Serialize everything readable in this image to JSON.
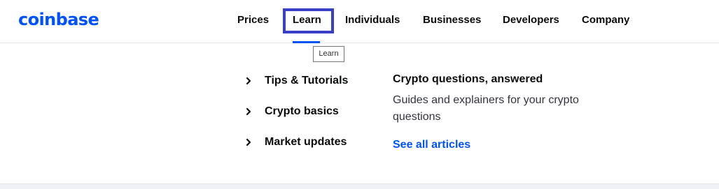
{
  "brand": {
    "logo_text": "coinbase",
    "color": "#0052ff"
  },
  "nav": {
    "items": [
      {
        "label": "Prices"
      },
      {
        "label": "Learn",
        "active": true
      },
      {
        "label": "Individuals"
      },
      {
        "label": "Businesses"
      },
      {
        "label": "Developers"
      },
      {
        "label": "Company"
      }
    ],
    "highlight_color": "#3a3fc8"
  },
  "tooltip": {
    "text": "Learn"
  },
  "dropdown": {
    "menu": [
      {
        "label": "Tips & Tutorials",
        "icon": "chevron-right-icon"
      },
      {
        "label": "Crypto basics",
        "icon": "chevron-right-icon"
      },
      {
        "label": "Market updates",
        "icon": "chevron-right-icon"
      }
    ],
    "feature": {
      "title": "Crypto questions, answered",
      "description": "Guides and explainers for your crypto questions",
      "link_label": "See all articles"
    }
  }
}
